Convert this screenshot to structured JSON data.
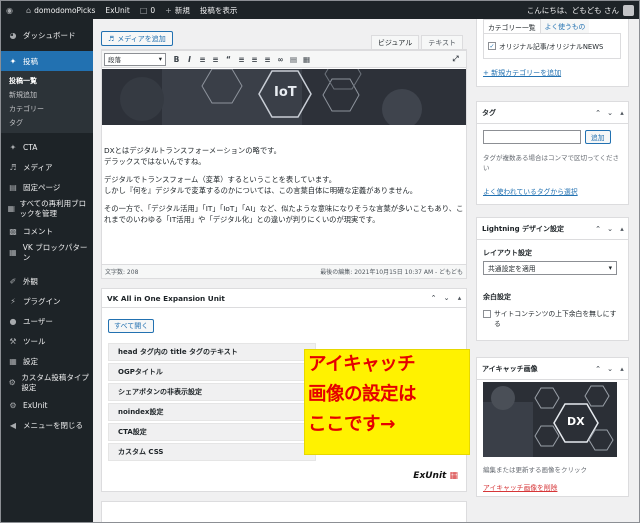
{
  "admin_bar": {
    "site_name": "domodomoPicks",
    "exunit": "ExUnit",
    "comments_count": "0",
    "new_label": "新規",
    "view_post": "投稿を表示",
    "greeting": "こんにちは、どもども さん"
  },
  "sidebar": {
    "dashboard": "ダッシュボード",
    "posts": "投稿",
    "posts_sub": [
      "投稿一覧",
      "新規追加",
      "カテゴリー",
      "タグ"
    ],
    "cta": "CTA",
    "media": "メディア",
    "pages": "固定ページ",
    "reusable": "すべての再利用ブロックを管理",
    "comments": "コメント",
    "vk_block": "VK ブロックパターン",
    "appearance": "外観",
    "plugins": "プラグイン",
    "users": "ユーザー",
    "tools": "ツール",
    "settings": "設定",
    "cpt": "カスタム投稿タイプ設定",
    "exunit": "ExUnit",
    "collapse": "メニューを閉じる"
  },
  "editor": {
    "add_media": "メディアを追加",
    "tab_visual": "ビジュアル",
    "tab_text": "テキスト",
    "format_select": "段落",
    "hero_text": "IoT",
    "paragraphs": [
      "DXとはデジタルトランスフォーメーションの略です。",
      "デラックスではないんですね。",
      "デジタルでトランスフォーム（変革）するということを表しています。",
      "しかし『何を』デジタルで変革するのかについては、この言葉自体に明確な定義がありません。",
      "その一方で、「デジタル活用」「IT」「IoT」「AI」など、似たような意味になりそうな言葉が多いこともあり、これまでのいわゆる「IT活用」や「デジタル化」との違いが判りにくいのが現実です。"
    ],
    "word_count": "文字数: 208",
    "last_edited": "最後の編集: 2021年10月15日 10:37 AM - どもども"
  },
  "exunit_box": {
    "title": "VK All in One Expansion Unit",
    "open_all": "すべて開く",
    "rows": [
      "head タグ内の title タグのテキスト",
      "OGPタイトル",
      "シェアボタンの非表示設定",
      "noindex設定",
      "CTA設定",
      "カスタム CSS"
    ],
    "logo": "ExUnit"
  },
  "callout": {
    "lines": [
      "アイキャッチ",
      "画像の設定は",
      "ここです→"
    ]
  },
  "category_box": {
    "tab_all": "カテゴリー一覧",
    "tab_popular": "よく使うもの",
    "item": "オリジナル記事/オリジナルNEWS",
    "add_new": "+ 新規カテゴリーを追加"
  },
  "tag_box": {
    "title": "タグ",
    "add_button": "追加",
    "hint": "タグが複数ある場合はコンマで区切ってください",
    "popular_link": "よく使われているタグから選択"
  },
  "lightning_box": {
    "title": "Lightning デザイン設定",
    "layout_label": "レイアウト設定",
    "layout_value": "共通設定を適用",
    "margin_label": "余白設定",
    "margin_checkbox": "サイトコンテンツの上下余白を無しにする"
  },
  "eyecatch_box": {
    "title": "アイキャッチ画像",
    "image_text": "DX",
    "hint": "編集または更新する画像をクリック",
    "remove": "アイキャッチ画像を削除"
  },
  "colors": {
    "admin_dark": "#1d2327",
    "accent_blue": "#2271b1",
    "callout_bg": "#fff200",
    "callout_text": "#e50000"
  }
}
